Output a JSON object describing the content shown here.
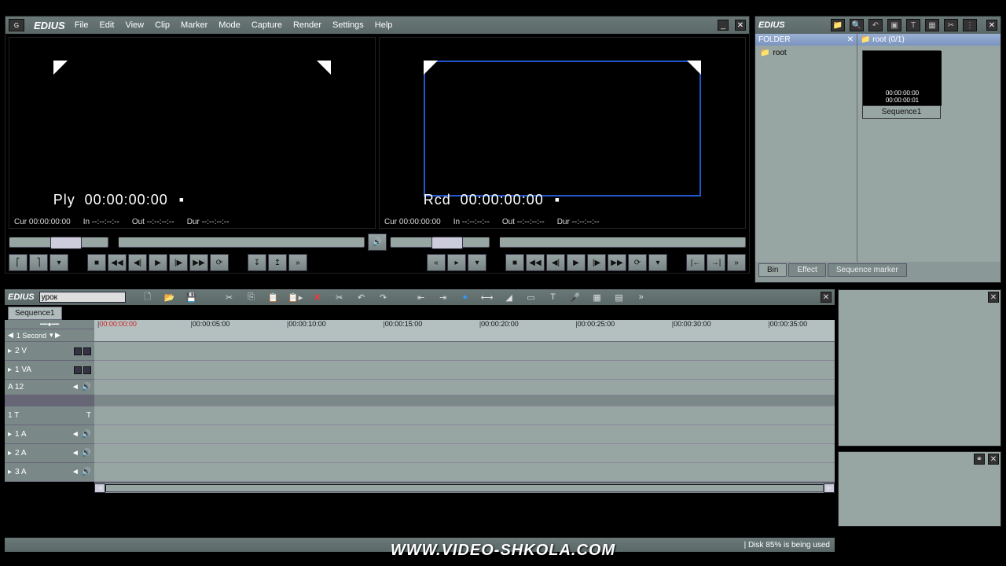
{
  "app": {
    "name": "EDIUS"
  },
  "menus": [
    "File",
    "Edit",
    "View",
    "Clip",
    "Marker",
    "Mode",
    "Capture",
    "Render",
    "Settings",
    "Help"
  ],
  "viewer": {
    "left": {
      "label": "Ply",
      "timecode": "00:00:00:00",
      "cur": "Cur 00:00:00:00",
      "in": "In --:--:--:--",
      "out": "Out --:--:--:--",
      "dur": "Dur --:--:--:--"
    },
    "right": {
      "label": "Rcd",
      "timecode": "00:00:00:00",
      "cur": "Cur 00:00:00:00",
      "in": "In --:--:--:--",
      "out": "Out --:--:--:--",
      "dur": "Dur --:--:--:--"
    }
  },
  "bin": {
    "folder_title": "FOLDER",
    "root_label": "root",
    "content_title": "root (0/1)",
    "thumb": {
      "tc1": "00:00:00:00",
      "tc2": "00:00:00:01",
      "name": "Sequence1"
    },
    "tabs": {
      "bin": "Bin",
      "effect": "Effect",
      "seq": "Sequence marker"
    }
  },
  "timeline": {
    "project_name": "урок",
    "sequence_tab": "Sequence1",
    "scale_label": "1 Second",
    "ruler": [
      "00:00:00:00",
      "00:00:05:00",
      "00:00:10:00",
      "00:00:15:00",
      "00:00:20:00",
      "00:00:25:00",
      "00:00:30:00",
      "00:00:35:00"
    ],
    "tracks": {
      "v2": "2 V",
      "va1": "1 VA",
      "va1_sub": "A 12",
      "t1": "1 T",
      "a1": "1 A",
      "a2": "2 A",
      "a3": "3 A"
    }
  },
  "status": {
    "disk": "Disk 85% is being used"
  },
  "watermark": "WWW.VIDEO-SHKOLA.COM"
}
